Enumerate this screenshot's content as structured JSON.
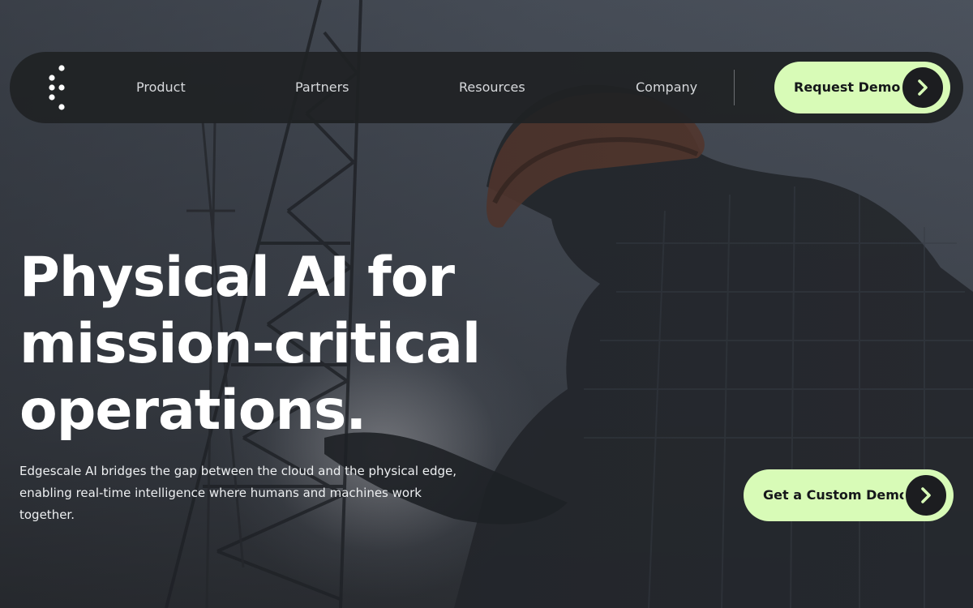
{
  "nav": {
    "links": [
      {
        "label": "Product"
      },
      {
        "label": "Partners"
      },
      {
        "label": "Resources"
      },
      {
        "label": "Company"
      }
    ],
    "cta_label": "Request Demo"
  },
  "hero": {
    "headline_lines": [
      "Physical AI for",
      "mission-critical",
      "operations."
    ],
    "subtext": "Edgescale AI bridges the gap between the cloud and the physical edge, enabling real-time intelligence where humans and machines work together.",
    "cta_label": "Get a Custom Demo"
  },
  "colors": {
    "accent": "#d8fbb7",
    "nav_background": "#202224",
    "arrow_circle": "#1c1d20",
    "text_light": "#ffffff"
  },
  "icons": {
    "logo": "dotted-logo-icon",
    "cta_arrow": "chevron-right-icon"
  }
}
